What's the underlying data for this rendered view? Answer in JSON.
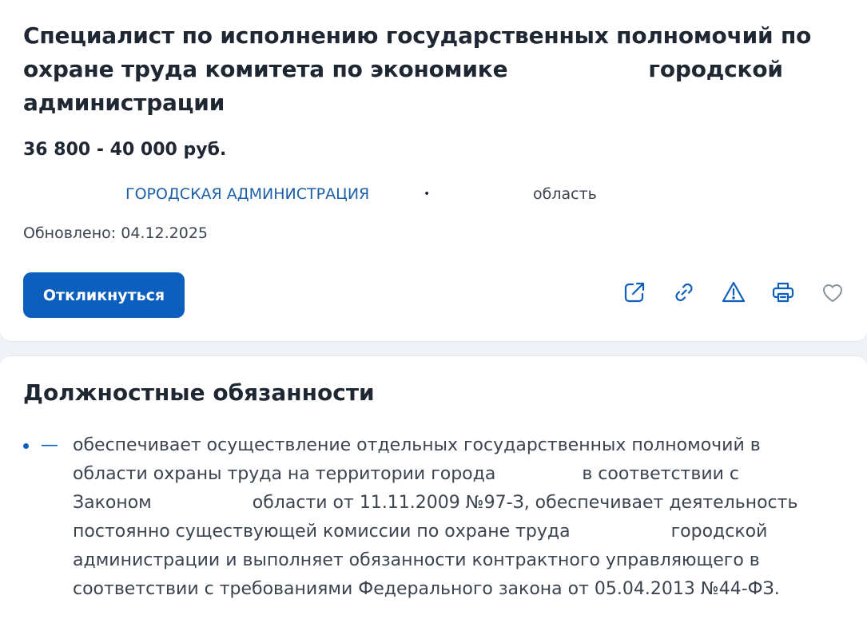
{
  "vacancy": {
    "title_line1": "Специалист по исполнению государственных полномочий по",
    "title_line2a": "охране труда комитета по экономике",
    "title_line2b": "городской",
    "title_line3": "администрации",
    "salary": "36 800 - 40 000 руб.",
    "employer": "ГОРОДСКАЯ АДМИНИСТРАЦИЯ",
    "separator": "•",
    "region": "область",
    "updated": "Обновлено: 04.12.2025",
    "apply_label": "Откликнуться"
  },
  "actions": {
    "icons": [
      "share-icon",
      "link-icon",
      "warning-icon",
      "print-icon",
      "heart-icon"
    ],
    "color": "#0d5fbd",
    "heart_color": "#8a929c"
  },
  "duties": {
    "heading": "Должностные обязанности",
    "dash": "—",
    "line1": "обеспечивает осуществление отдельных государственных полномочий в",
    "line2a": "области охраны труда на территории города",
    "line2b": "в соответствии с",
    "line3a": "Законом",
    "line3b": "области от 11.11.2009 №97-З, обеспечивает деятельность",
    "line4a": "постоянно существующей комиссии по охране труда",
    "line4b": "городской",
    "line5": "администрации и выполняет обязанности контрактного управляющего в",
    "line6": "соответствии с требованиями Федерального закона от 05.04.2013 №44-ФЗ."
  },
  "colors": {
    "accent": "#0d5fbd",
    "link": "#1a5fa8",
    "text": "#1f2733",
    "muted": "#3c4450",
    "background": "#eef1f5"
  }
}
